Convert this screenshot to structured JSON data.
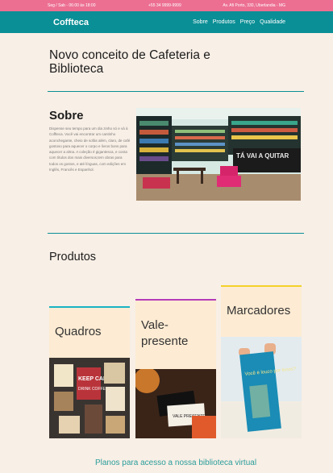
{
  "topbar": {
    "hours": "Seg / Sab - 06:00 às 18:00",
    "phone": "+55 34 9999-9999",
    "address": "Av. Afi Porto, 330, Uberlandia - MG"
  },
  "nav": {
    "logo": "Coffteca",
    "links": [
      "Sobre",
      "Produtos",
      "Preço",
      "Qualidade"
    ]
  },
  "hero": {
    "title": "Novo conceito de Cafeteria e Biblioteca"
  },
  "sobre": {
    "title": "Sobre",
    "text": "Dispense seu tempo para um dia zinho só e vá à Coffteca. Você vai encontrar um cantinho aconchegante, cheio de sofás além, claro, de café gostoso para aquecer o corpo e livros bons para aquecer a alma. A coleção é gigantesca, e conta com títulos dos mais diversos,tem obras para todos os gostos, e até línguas, com edições em Inglês, Francês e Espanhol.",
    "sign_text": "TÁ VAI A QUITAR"
  },
  "produtos": {
    "title": "Produtos",
    "cards": [
      {
        "label": "Quadros",
        "color": "#19b3c4",
        "poster": "KEEP CALM",
        "poster2": "DRINK COFFEE"
      },
      {
        "label": "Vale-presente",
        "color": "#b63bb8",
        "card_text": "VALE PRESENTE"
      },
      {
        "label": "Marcadores",
        "color": "#f3d228",
        "bm_text": "Você é louco por livros?"
      }
    ]
  },
  "footer": {
    "link": "Planos para acesso a nossa biblioteca virtual"
  },
  "colors": {
    "accent": "#0a8f96",
    "topbar": "#ec6f92",
    "background": "#f8efe6"
  }
}
